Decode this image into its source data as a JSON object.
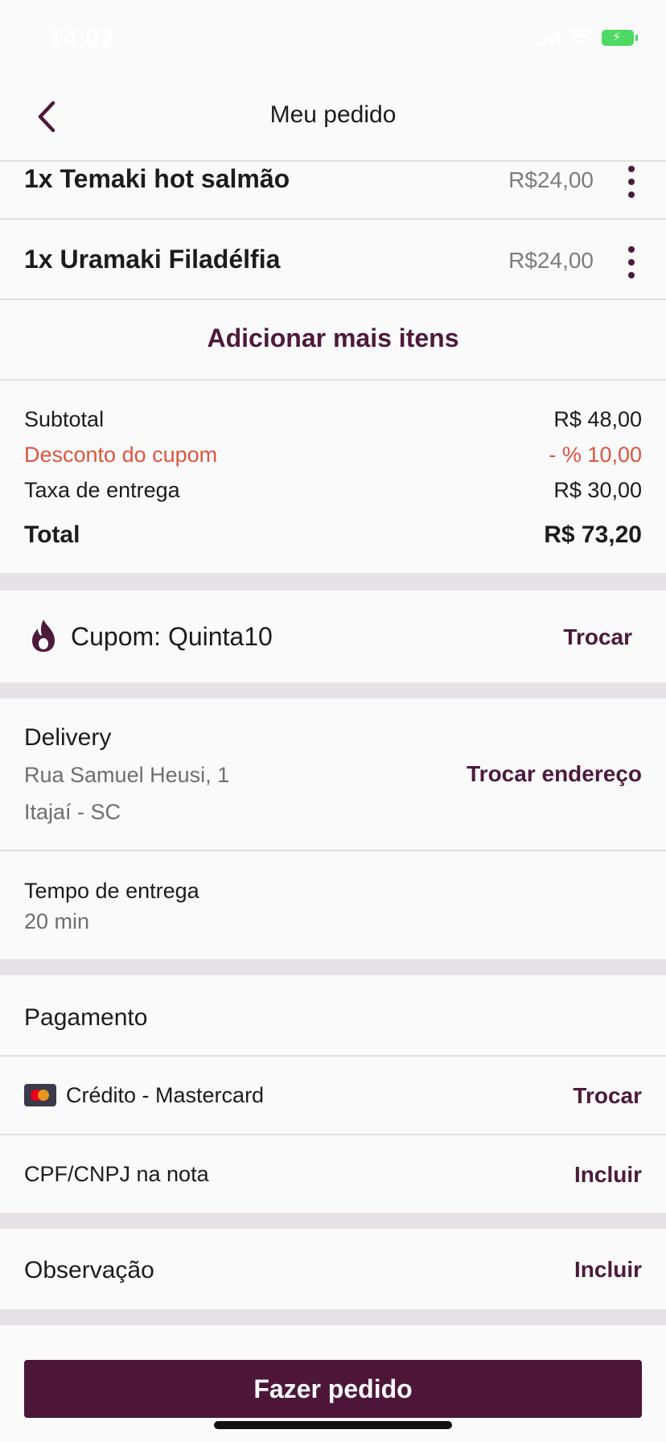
{
  "status_bar": {
    "time": "14:02"
  },
  "header": {
    "title": "Meu pedido"
  },
  "items": [
    {
      "name": "1x Temaki hot salmão",
      "price": "R$24,00"
    },
    {
      "name": "1x Uramaki Filadélfia",
      "price": "R$24,00"
    }
  ],
  "add_more_label": "Adicionar mais itens",
  "summary": {
    "subtotal_label": "Subtotal",
    "subtotal_value": "R$ 48,00",
    "discount_label": "Desconto do cupom",
    "discount_value": "- % 10,00",
    "delivery_fee_label": "Taxa de entrega",
    "delivery_fee_value": "R$ 30,00",
    "total_label": "Total",
    "total_value": "R$ 73,20"
  },
  "coupon": {
    "label": "Cupom: Quinta10",
    "action": "Trocar"
  },
  "delivery": {
    "title": "Delivery",
    "address_line1": "Rua Samuel Heusi, 1",
    "address_line2": "Itajaí - SC",
    "action": "Trocar endereço"
  },
  "delivery_time": {
    "label": "Tempo de entrega",
    "value": "20 min"
  },
  "payment": {
    "title": "Pagamento",
    "method": "Crédito - Mastercard",
    "method_action": "Trocar",
    "tax_id_label": "CPF/CNPJ na nota",
    "tax_id_action": "Incluir"
  },
  "notes": {
    "label": "Observação",
    "action": "Incluir"
  },
  "order_button_label": "Fazer pedido",
  "colors": {
    "accent": "#4d1a3b",
    "discount": "#e0533e",
    "button": "#4d1639",
    "separator": "#e6e2e6"
  }
}
